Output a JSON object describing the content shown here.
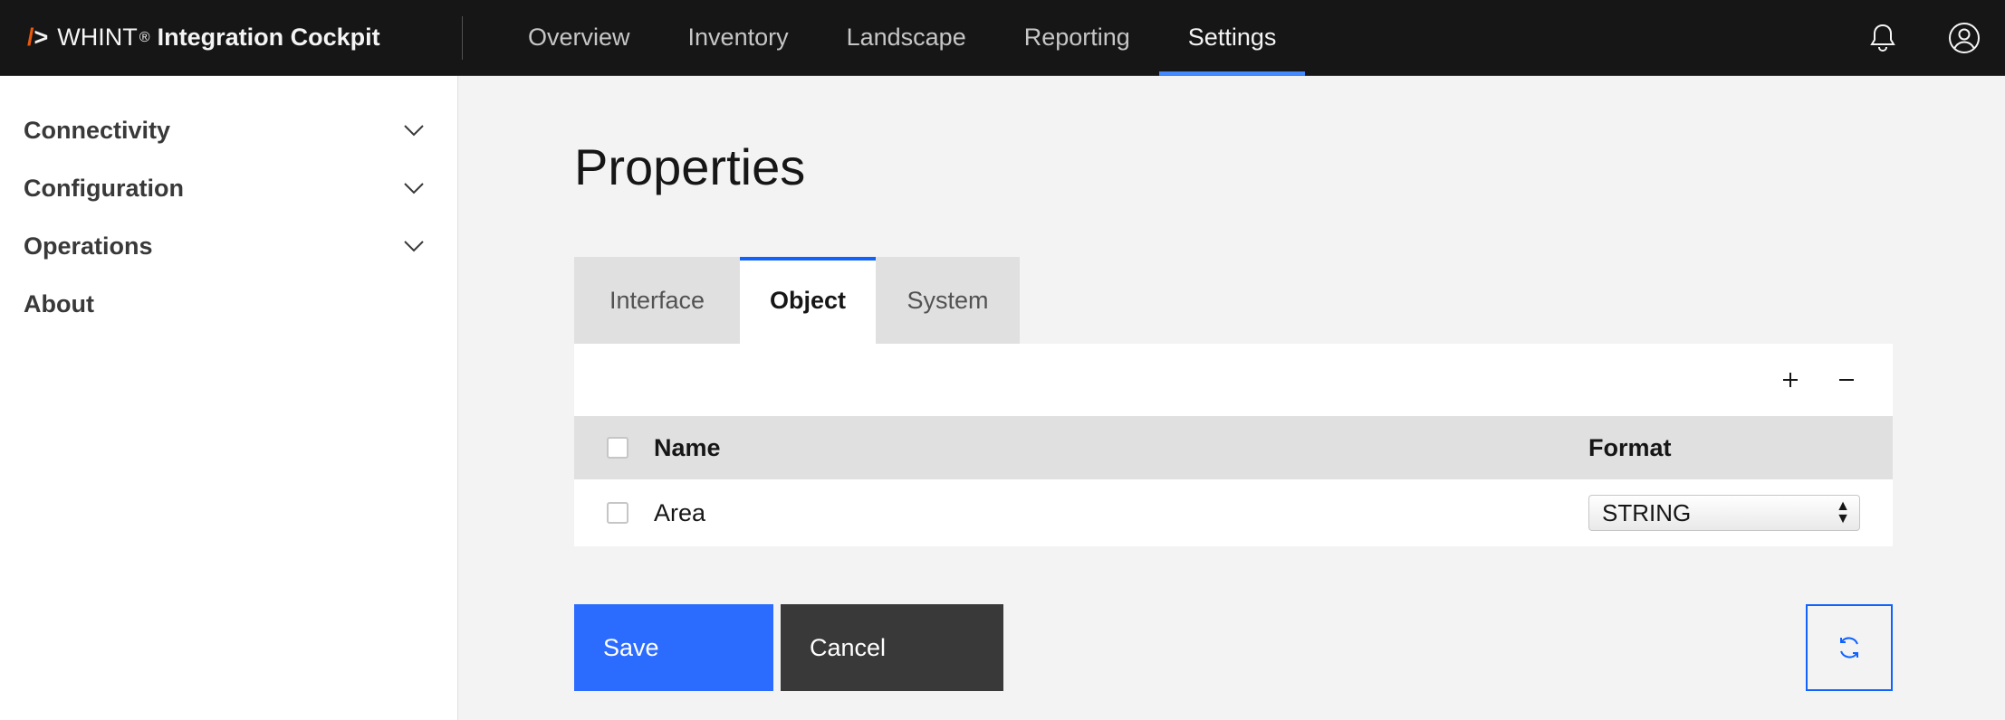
{
  "header": {
    "brand_slash": "/",
    "brand_gt": ">",
    "brand_name": "WHINT",
    "brand_reg": "®",
    "brand_product": "Integration Cockpit",
    "nav": [
      {
        "label": "Overview"
      },
      {
        "label": "Inventory"
      },
      {
        "label": "Landscape"
      },
      {
        "label": "Reporting"
      },
      {
        "label": "Settings",
        "active": true
      }
    ],
    "icons": [
      "bell-icon",
      "user-avatar-icon"
    ]
  },
  "sidebar": {
    "items": [
      {
        "label": "Connectivity",
        "expandable": true
      },
      {
        "label": "Configuration",
        "expandable": true
      },
      {
        "label": "Operations",
        "expandable": true
      },
      {
        "label": "About",
        "expandable": false
      }
    ]
  },
  "main": {
    "title": "Properties",
    "tabs": [
      {
        "label": "Interface"
      },
      {
        "label": "Object",
        "active": true
      },
      {
        "label": "System"
      }
    ],
    "toolbar": {
      "add_icon": "plus-icon",
      "remove_icon": "minus-icon"
    },
    "table": {
      "columns": [
        "Name",
        "Format"
      ],
      "rows": [
        {
          "name": "Area",
          "format": "STRING"
        }
      ]
    },
    "buttons": {
      "save": "Save",
      "cancel": "Cancel",
      "refresh_icon": "refresh-icon"
    }
  },
  "colors": {
    "header_bg": "#161616",
    "accent": "#0f62fe",
    "nav_indicator": "#4589ff",
    "save_bg": "#2b6cff",
    "cancel_bg": "#393939",
    "brand_slash": "#e8590c"
  }
}
